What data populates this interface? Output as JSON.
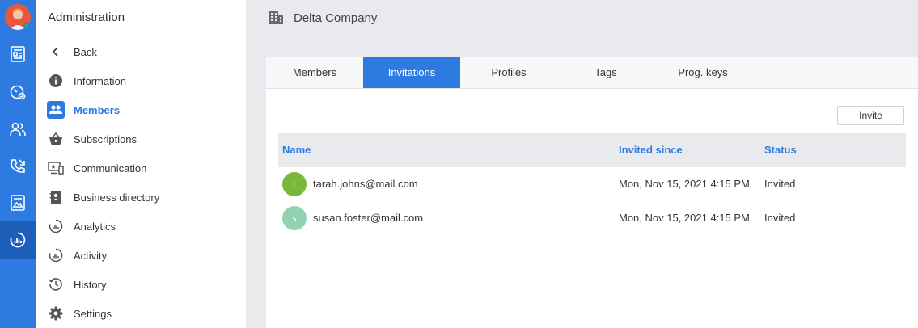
{
  "sidebar": {
    "title": "Administration",
    "items": [
      {
        "label": "Back",
        "icon": "chevron-left-icon"
      },
      {
        "label": "Information",
        "icon": "info-icon"
      },
      {
        "label": "Members",
        "icon": "members-icon",
        "active": true
      },
      {
        "label": "Subscriptions",
        "icon": "basket-icon"
      },
      {
        "label": "Communication",
        "icon": "communication-icon"
      },
      {
        "label": "Business directory",
        "icon": "directory-icon"
      },
      {
        "label": "Analytics",
        "icon": "analytics-icon"
      },
      {
        "label": "Activity",
        "icon": "activity-icon"
      },
      {
        "label": "History",
        "icon": "history-icon"
      },
      {
        "label": "Settings",
        "icon": "gear-icon"
      }
    ]
  },
  "header": {
    "title": "Delta Company",
    "icon": "building-icon"
  },
  "tabs": [
    {
      "label": "Members"
    },
    {
      "label": "Invitations",
      "active": true
    },
    {
      "label": "Profiles"
    },
    {
      "label": "Tags"
    },
    {
      "label": "Prog. keys"
    }
  ],
  "invite_label": "Invite",
  "table": {
    "columns": [
      "Name",
      "Invited since",
      "Status"
    ],
    "rows": [
      {
        "initial": "t",
        "avatar_color": "#78b83a",
        "email": "tarah.johns@mail.com",
        "invited": "Mon, Nov 15, 2021 4:15 PM",
        "status": "Invited"
      },
      {
        "initial": "s",
        "avatar_color": "#93d2b1",
        "email": "susan.foster@mail.com",
        "invited": "Mon, Nov 15, 2021 4:15 PM",
        "status": "Invited"
      }
    ]
  },
  "colors": {
    "accent": "#2d7be0",
    "rail_active": "#1d5fb8"
  }
}
